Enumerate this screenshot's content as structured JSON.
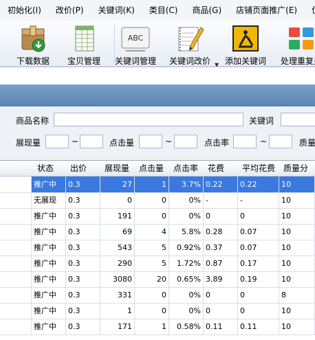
{
  "menu": [
    "初始化(I)",
    "改价(P)",
    "关键词(K)",
    "类目(C)",
    "商品(G)",
    "店铺页面推广(E)",
    "优化"
  ],
  "toolbar": [
    {
      "label": "下载数据",
      "icon": "download-box-icon"
    },
    {
      "label": "宝贝管理",
      "icon": "spreadsheet-icon"
    },
    {
      "label": "关键词管理",
      "icon": "abc-keyword-icon"
    },
    {
      "label": "关键词改价",
      "icon": "pencil-notebook-icon"
    },
    {
      "label": "添加关键词",
      "icon": "construction-sign-icon"
    },
    {
      "label": "处理重复关",
      "icon": "colored-blocks-icon"
    }
  ],
  "search": {
    "product_name": "商品名称",
    "keyword": "关键词",
    "impressions": "展现量",
    "clicks": "点击量",
    "ctr": "点击率",
    "quality": "质量",
    "tilde": "~"
  },
  "table": {
    "headers": [
      "状态",
      "出价",
      "展现量",
      "点击量",
      "点击率",
      "花费",
      "平均花费",
      "质量分"
    ],
    "rows": [
      [
        "推广中",
        "0.3",
        "27",
        "1",
        "3.7%",
        "0.22",
        "0.22",
        "10"
      ],
      [
        "无展现",
        "0.3",
        "0",
        "0",
        "0%",
        "-",
        "-",
        "10"
      ],
      [
        "推广中",
        "0.3",
        "191",
        "0",
        "0%",
        "0",
        "0",
        "10"
      ],
      [
        "推广中",
        "0.3",
        "69",
        "4",
        "5.8%",
        "0.28",
        "0.07",
        "10"
      ],
      [
        "推广中",
        "0.3",
        "543",
        "5",
        "0.92%",
        "0.37",
        "0.07",
        "10"
      ],
      [
        "推广中",
        "0.3",
        "290",
        "5",
        "1.72%",
        "0.87",
        "0.17",
        "10"
      ],
      [
        "推广中",
        "0.3",
        "3080",
        "20",
        "0.65%",
        "3.89",
        "0.19",
        "10"
      ],
      [
        "推广中",
        "0.3",
        "331",
        "0",
        "0%",
        "0",
        "0",
        "8"
      ],
      [
        "推广中",
        "0.3",
        "1",
        "0",
        "0%",
        "0",
        "0",
        "10"
      ],
      [
        "推广中",
        "0.3",
        "171",
        "1",
        "0.58%",
        "0.11",
        "0.11",
        "10"
      ]
    ]
  },
  "colors": {
    "selected_row": "#3a79e0",
    "band": "#6b93c0"
  }
}
